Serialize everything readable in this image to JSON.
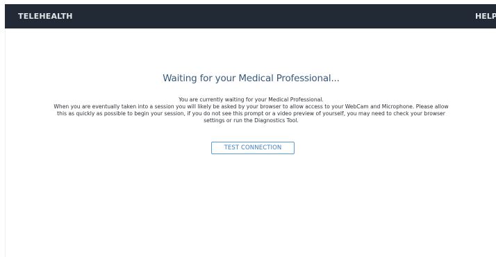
{
  "header": {
    "title": "TELEHEALTH",
    "help_label": "HELP"
  },
  "main": {
    "heading": "Waiting for your Medical Professional...",
    "message_lines": [
      "You are currently waiting for your Medical Professional.",
      "When you are eventually taken into a session you will likely be asked by your browser to allow access to your WebCam and Microphone. Please allow",
      "this as quickly as possible to begin your session, if you do not see this prompt or a video preview of yourself, you may need to check your browser",
      "settings or run the Diagnostics Tool."
    ],
    "test_button_label": "TEST CONNECTION"
  },
  "colors": {
    "header_bg": "#222a35",
    "header_text": "#e3e7ec",
    "heading_text": "#38597a",
    "button_border": "#5c9ed3",
    "button_text": "#3c7ec1"
  }
}
